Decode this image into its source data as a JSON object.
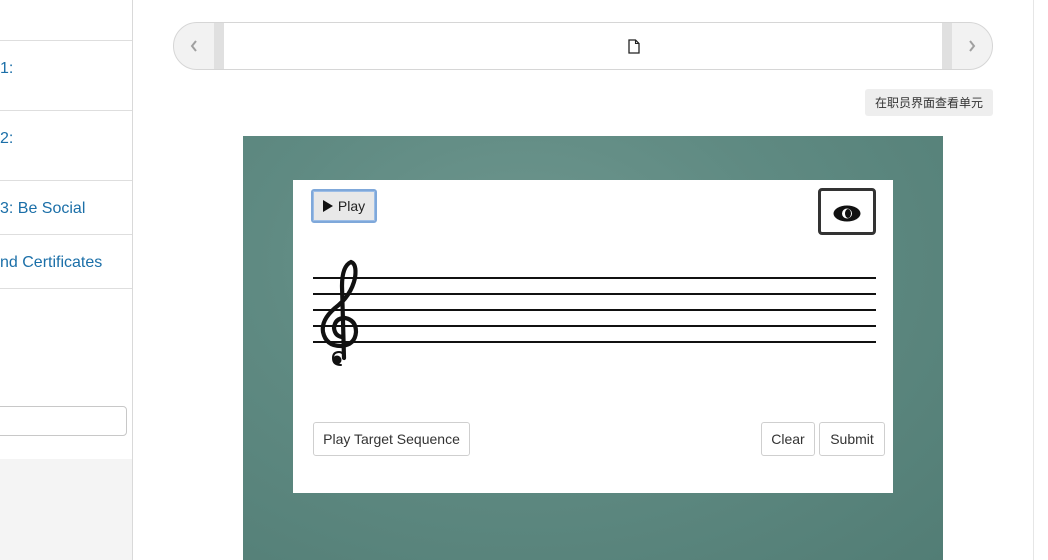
{
  "sidebar": {
    "items": [
      {
        "label": "1:"
      },
      {
        "label": "2:"
      },
      {
        "label": "3: Be Social"
      },
      {
        "label": "nd Certificates"
      }
    ]
  },
  "sequence": {
    "prev_icon": "chevron-left-icon",
    "next_icon": "chevron-right-icon",
    "unit_icon": "document-icon"
  },
  "staff_view_button": "在职员界面查看单元",
  "exercise": {
    "play_label": "Play",
    "play_icon": "play-triangle-icon",
    "toggle_icon": "eye-icon",
    "clef": "treble-clef",
    "play_target_label": "Play Target Sequence",
    "clear_label": "Clear",
    "submit_label": "Submit"
  }
}
